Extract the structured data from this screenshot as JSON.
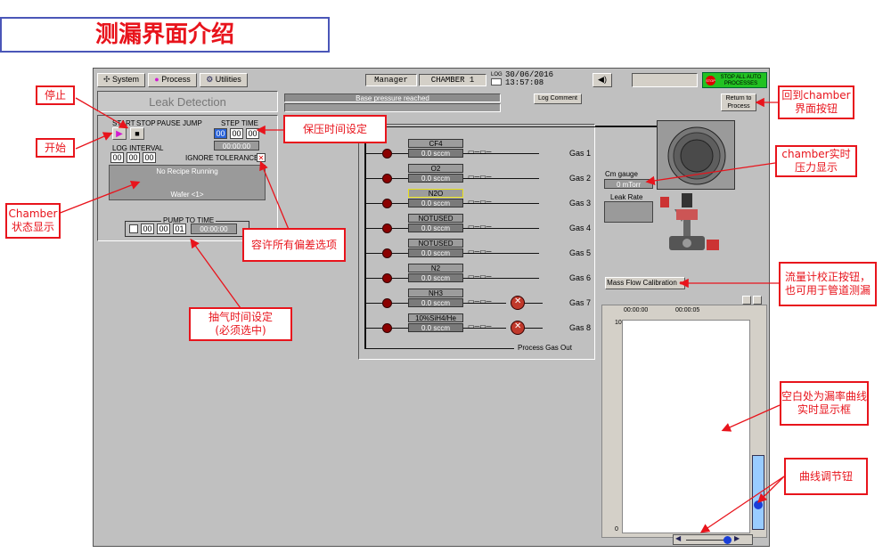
{
  "doc_title": "测漏界面介绍",
  "toolbar": {
    "system_label": "System",
    "process_label": "Process",
    "utilities_label": "Utilities",
    "user": "Manager",
    "chamber": "CHAMBER 1",
    "log_label": "LOG",
    "date": "30/06/2016",
    "time": "13:57:08",
    "stop_all_label_1": "STOP ALL AUTO",
    "stop_all_label_2": "PROCESSES",
    "stop_badge": "STOP"
  },
  "leak": {
    "title": "Leak Detection",
    "status_message": "Base pressure reached",
    "log_comment_label": "Log Comment",
    "return_label_1": "Return to",
    "return_label_2": "Process",
    "start_label": "START",
    "stop_label": "STOP",
    "pause_label": "PAUSE",
    "jump_label": "JUMP",
    "step_time_label": "STEP TIME",
    "step_time_h": "00",
    "step_time_m": "00",
    "step_time_s": "00",
    "step_time_display": "00:00:00",
    "log_interval_label": "LOG INTERVAL",
    "log_interval_h": "00",
    "log_interval_m": "00",
    "log_interval_s": "00",
    "ignore_tolerance_label": "IGNORE TOLERANCE",
    "recipe_status": "No Recipe Running",
    "wafer_status": "Wafer <1>",
    "pump_to_time_label": "PUMP TO TIME",
    "pump_h": "00",
    "pump_m": "00",
    "pump_s": "01",
    "pump_display": "00:00:00"
  },
  "gases": [
    {
      "name": "CF4",
      "flow": "0.0 sccm",
      "label": "Gas 1"
    },
    {
      "name": "O2",
      "flow": "0.0 sccm",
      "label": "Gas 2"
    },
    {
      "name": "N2O",
      "flow": "0.0 sccm",
      "label": "Gas 3"
    },
    {
      "name": "NOTUSED",
      "flow": "0.0 sccm",
      "label": "Gas 4"
    },
    {
      "name": "NOTUSED",
      "flow": "0.0 sccm",
      "label": "Gas 5"
    },
    {
      "name": "N2",
      "flow": "0.0 sccm",
      "label": "Gas 6"
    },
    {
      "name": "NH3",
      "flow": "0.0 sccm",
      "label": "Gas 7"
    },
    {
      "name": "10%SiH4/He",
      "flow": "0.0 sccm",
      "label": "Gas 8"
    }
  ],
  "process_gas_out": "Process Gas Out",
  "gauge": {
    "label": "Cm gauge",
    "value": "0 mTorr",
    "leak_rate_label": "Leak Rate"
  },
  "mfc_button_label": "Mass Flow Calibration",
  "trend": {
    "time_1": "00:00:00",
    "time_2": "00:00:05",
    "y_max": "10",
    "y_min": "0"
  },
  "callouts": {
    "stop": "停止",
    "start": "开始",
    "chamber_status": "Chamber状态显示",
    "hold_time": "保压时间设定",
    "ignore_tolerance": "容许所有偏差选项",
    "pump_time_1": "抽气时间设定",
    "pump_time_2": "(必须选中)",
    "return_chamber": "回到chamber界面按钮",
    "chamber_pressure": "chamber实时压力显示",
    "mfc": "流量计校正按钮，也可用于管道测漏",
    "leak_curve": "空白处为漏率曲线实时显示框",
    "curve_adjust": "曲线调节钮"
  },
  "colors": {
    "accent_red": "#e8141c",
    "panel_grey": "#c0c0c0",
    "stop_green": "#22c222",
    "play_magenta": "#d11bd1"
  }
}
